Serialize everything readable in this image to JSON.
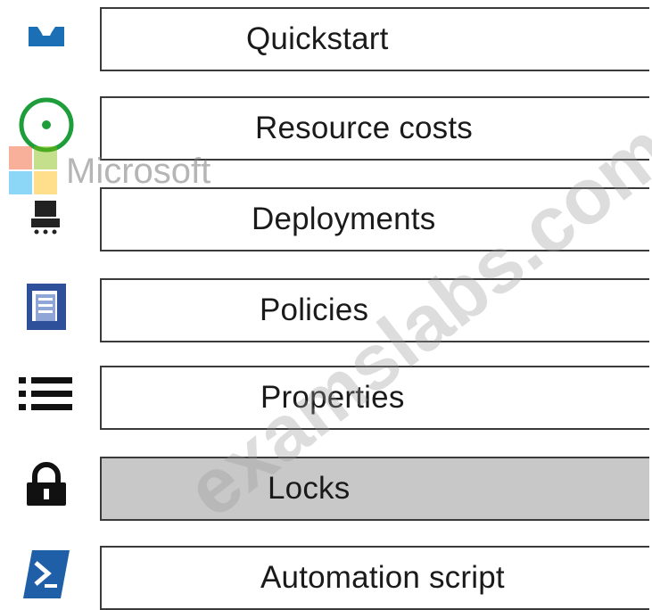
{
  "menu": {
    "items": [
      {
        "label": "Quickstart",
        "icon": "quickstart-icon",
        "selected": false
      },
      {
        "label": "Resource costs",
        "icon": "resource-costs-icon",
        "selected": false
      },
      {
        "label": "Deployments",
        "icon": "deployments-icon",
        "selected": false
      },
      {
        "label": "Policies",
        "icon": "policies-icon",
        "selected": false
      },
      {
        "label": "Properties",
        "icon": "properties-icon",
        "selected": false
      },
      {
        "label": "Locks",
        "icon": "lock-icon",
        "selected": true
      },
      {
        "label": "Automation script",
        "icon": "automation-script-icon",
        "selected": false
      }
    ]
  },
  "watermarks": {
    "vendor": "Microsoft",
    "site": "examslabs.com"
  },
  "colors": {
    "quickstart": "#1a6fb5",
    "resource_costs": "#1e9e3a",
    "policies": "#2e4f9a",
    "automation_script": "#1f5fa8",
    "selected_background": "#c8c8c8",
    "border": "#3a3a3a",
    "ms_red": "#f25022",
    "ms_green": "#7fba00",
    "ms_blue": "#00a4ef",
    "ms_yellow": "#ffb900"
  }
}
